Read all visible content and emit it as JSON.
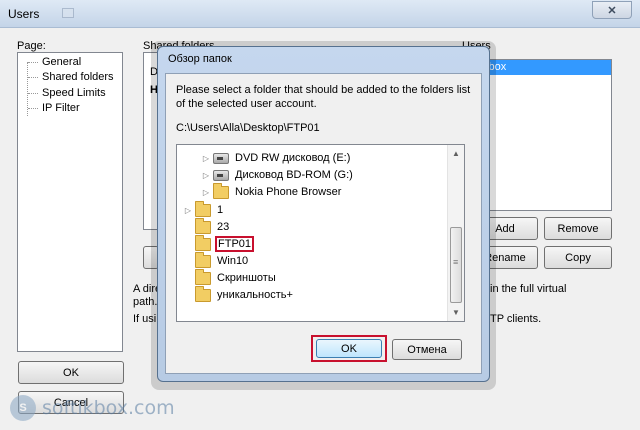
{
  "window": {
    "title": "Users",
    "close_glyph": "✕"
  },
  "left": {
    "page_label": "Page:",
    "tree": [
      {
        "label": "General"
      },
      {
        "label": "Shared folders"
      },
      {
        "label": "Speed Limits"
      },
      {
        "label": "IP Filter"
      }
    ],
    "ok_label": "OK",
    "cancel_label": "Cancel"
  },
  "shared": {
    "heading": "Shared folders",
    "col_fragment": "D",
    "row_fragment": "H",
    "note1": "A dire",
    "note1_suffix": "in the full virtual",
    "note2": "path.",
    "note3": "If usi",
    "note3_suffix": "TP clients."
  },
  "users": {
    "heading": "Users",
    "selected": "kbox",
    "add_label": "Add",
    "remove_label": "Remove",
    "rename_label": "Rename",
    "copy_label": "Copy"
  },
  "dialog": {
    "title": "Обзор папок",
    "description": "Please select a folder that should be added to the folders list of the selected user account.",
    "path": "C:\\Users\\Alla\\Desktop\\FTP01",
    "folders": [
      {
        "label": "DVD RW дисковод (E:)",
        "icon": "drive-icon",
        "level": 2,
        "expander": true,
        "highlight": false
      },
      {
        "label": "Дисковод BD-ROM (G:)",
        "icon": "drive-icon",
        "level": 2,
        "expander": true,
        "highlight": false
      },
      {
        "label": "Nokia Phone Browser",
        "icon": "folder-icon",
        "level": 2,
        "expander": true,
        "highlight": false
      },
      {
        "label": "1",
        "icon": "folder-icon",
        "level": 1,
        "expander": true,
        "highlight": false
      },
      {
        "label": "23",
        "icon": "folder-icon",
        "level": 1,
        "expander": false,
        "highlight": false
      },
      {
        "label": "FTP01",
        "icon": "folder-icon",
        "level": 1,
        "expander": false,
        "highlight": true
      },
      {
        "label": "Win10",
        "icon": "folder-icon",
        "level": 1,
        "expander": false,
        "highlight": false
      },
      {
        "label": "Скриншоты",
        "icon": "folder-icon",
        "level": 1,
        "expander": false,
        "highlight": false
      },
      {
        "label": "уникальность+",
        "icon": "folder-icon",
        "level": 1,
        "expander": false,
        "highlight": false
      }
    ],
    "ok_label": "OK",
    "cancel_label": "Отмена",
    "highlight_color": "#c8102e"
  },
  "watermark": {
    "text": "softikbox.com",
    "logo_glyph": "S"
  }
}
